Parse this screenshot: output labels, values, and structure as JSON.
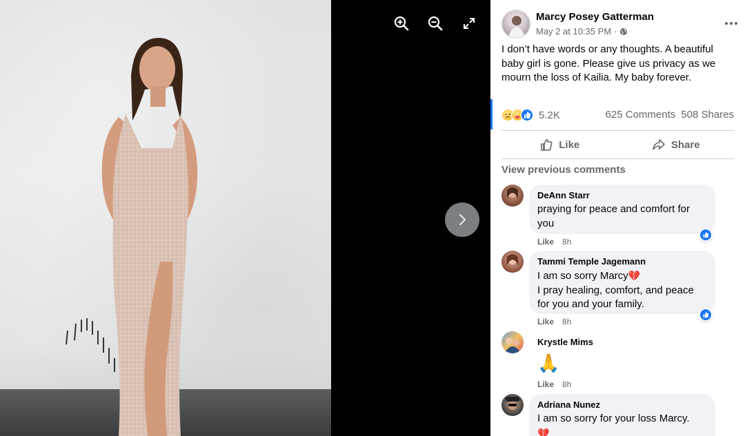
{
  "viewer": {
    "tools": [
      {
        "icon": "zoom-in-icon"
      },
      {
        "icon": "zoom-out-icon"
      },
      {
        "icon": "fullscreen-icon"
      }
    ],
    "next_icon": "chevron-right-icon"
  },
  "post": {
    "author": "Marcy Posey Gatterman",
    "timestamp": "May 2 at 10:35 PM",
    "separator": "·",
    "privacy_icon": "globe-icon",
    "text": "I don’t have words or any thoughts. A beautiful baby girl is gone. Please give us privacy as we mourn the loss of Kailia. My baby forever.",
    "reactions": {
      "icons": [
        "sad-reaction-icon",
        "care-reaction-icon",
        "like-reaction-icon"
      ],
      "count": "5.2K"
    },
    "comments_count": "625 Comments",
    "shares_count": "508 Shares",
    "actions": {
      "like_label": "Like",
      "share_label": "Share"
    }
  },
  "comments_section": {
    "view_previous": "View previous comments",
    "comments": [
      {
        "name": "DeAnn Starr",
        "lines": [
          "praying for peace and comfort for",
          "you"
        ],
        "like_label": "Like",
        "time": "8h",
        "has_like_badge": true
      },
      {
        "name": "Tammi Temple Jagemann",
        "lines": [
          "I am so sorry Marcy",
          "I pray healing, comfort, and peace",
          "for you and your family."
        ],
        "heart": "💔",
        "like_label": "Like",
        "time": "8h",
        "has_like_badge": true
      },
      {
        "name": "Krystle Mims",
        "emoji": "🙏",
        "like_label": "Like",
        "time": "8h",
        "has_like_badge": false
      },
      {
        "name": "Adriana Nunez",
        "lines": [
          "I am so sorry for your loss Marcy."
        ],
        "heart": "💔",
        "like_label": "",
        "time": "",
        "has_like_badge": false
      }
    ]
  },
  "colors": {
    "accent": "#1877f2",
    "muted_text": "#65676b",
    "bubble_bg": "#f0f2f5",
    "heart": "#e0245e"
  }
}
